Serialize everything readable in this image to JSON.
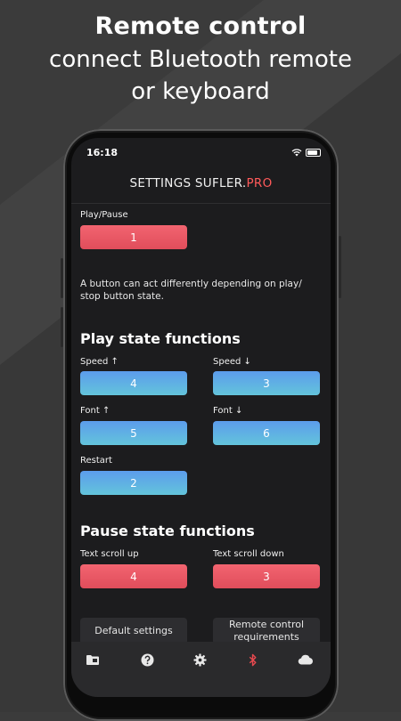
{
  "headline": {
    "title": "Remote control",
    "line2": "connect Bluetooth remote",
    "line3": "or keyboard"
  },
  "status": {
    "time": "16:18"
  },
  "app": {
    "title_main": "SETTINGS SUFLER.",
    "title_accent": "PRO"
  },
  "play_pause": {
    "label": "Play/Pause",
    "value": "1"
  },
  "description": "A button can act differently depending on play/ stop button state.",
  "play_state": {
    "heading": "Play state functions",
    "speed_up": {
      "label": "Speed ↑",
      "value": "4"
    },
    "speed_down": {
      "label": "Speed ↓",
      "value": "3"
    },
    "font_up": {
      "label": "Font ↑",
      "value": "5"
    },
    "font_down": {
      "label": "Font ↓",
      "value": "6"
    },
    "restart": {
      "label": "Restart",
      "value": "2"
    }
  },
  "pause_state": {
    "heading": "Pause state functions",
    "scroll_up": {
      "label": "Text scroll up",
      "value": "4"
    },
    "scroll_down": {
      "label": "Text scroll down",
      "value": "3"
    }
  },
  "footer": {
    "default_settings": "Default settings",
    "requirements": "Remote control requirements"
  },
  "tabs": {
    "active": "bluetooth",
    "icons": [
      "folder-icon",
      "help-icon",
      "gear-icon",
      "bluetooth-icon",
      "cloud-icon"
    ]
  },
  "colors": {
    "accent_red": "#e04d5b",
    "accent_blue": "#5c9cec",
    "screen_bg": "#1c1c1e",
    "tab_active": "#e8494f"
  }
}
